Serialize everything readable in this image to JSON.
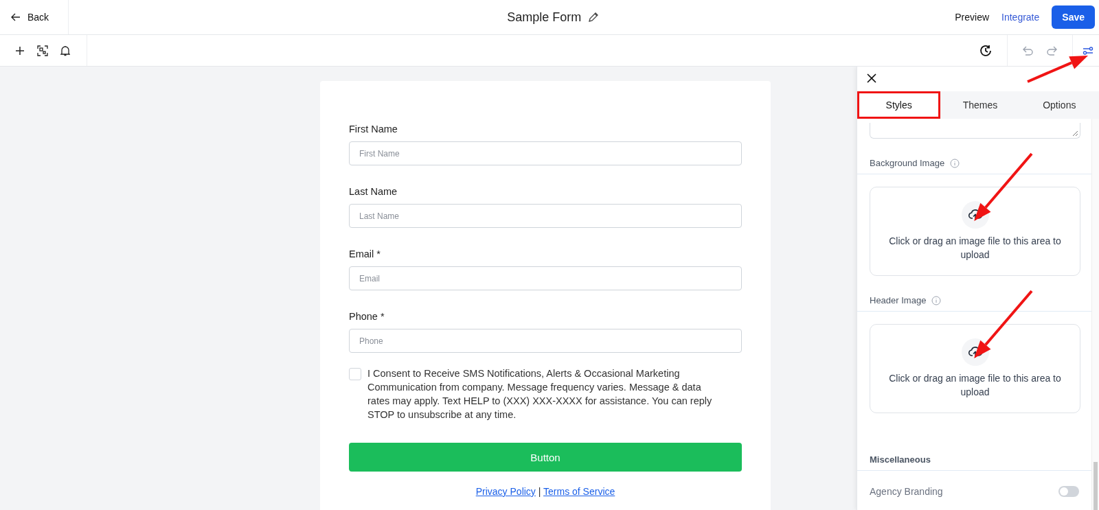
{
  "header": {
    "back": "Back",
    "title": "Sample Form",
    "preview": "Preview",
    "integrate": "Integrate",
    "save": "Save"
  },
  "toolbar": {
    "settings_annotated": true
  },
  "form": {
    "fields": [
      {
        "label": "First Name",
        "placeholder": "First Name"
      },
      {
        "label": "Last Name",
        "placeholder": "Last Name"
      },
      {
        "label": "Email *",
        "placeholder": "Email"
      },
      {
        "label": "Phone *",
        "placeholder": "Phone"
      }
    ],
    "consent": {
      "checked": false,
      "text": "I Consent to Receive SMS Notifications, Alerts & Occasional Marketing Communication from company. Message frequency varies. Message & data rates may apply. Text HELP to (XXX) XXX-XXXX for assistance. You can reply STOP to unsubscribe at any time."
    },
    "submit": "Button",
    "links": [
      "Privacy Policy",
      "Terms of Service"
    ],
    "separator": "|"
  },
  "panel": {
    "tabs": [
      {
        "label": "Styles",
        "selected": true,
        "highlighted": true
      },
      {
        "label": "Themes",
        "selected": false,
        "highlighted": false
      },
      {
        "label": "Options",
        "selected": false,
        "highlighted": false
      }
    ],
    "sections": [
      {
        "kind": "upload",
        "title": "Background Image",
        "hint": "Click or drag an image file to this area to upload",
        "annotated": true
      },
      {
        "kind": "upload",
        "title": "Header Image",
        "hint": "Click or drag an image file to this area to upload",
        "annotated": true
      },
      {
        "kind": "heading",
        "title": "Miscellaneous"
      },
      {
        "kind": "toggle",
        "title": "Agency Branding",
        "on": false
      }
    ]
  }
}
